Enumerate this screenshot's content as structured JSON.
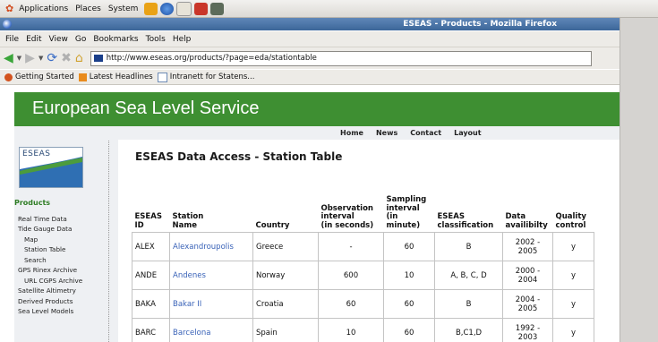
{
  "gnome_panel": {
    "menus": [
      "Applications",
      "Places",
      "System"
    ]
  },
  "window": {
    "title": "ESEAS - Products - Mozilla Firefox"
  },
  "menu_bar": [
    "File",
    "Edit",
    "View",
    "Go",
    "Bookmarks",
    "Tools",
    "Help"
  ],
  "address_bar": {
    "url": "http://www.eseas.org/products/?page=eda/stationtable"
  },
  "bookmarks": [
    "Getting Started",
    "Latest Headlines",
    "Intranett for Statens..."
  ],
  "page": {
    "banner_title": "European Sea Level Service",
    "top_nav": [
      "Home",
      "News",
      "Contact",
      "Layout"
    ],
    "logo_text": "ESEAS",
    "heading": "ESEAS Data Access - Station Table",
    "side_nav": {
      "header": "Products",
      "items": [
        "Real Time Data",
        "Tide Gauge Data",
        "Map",
        "Station Table",
        "Search",
        "GPS Rinex Archive",
        "URL CGPS Archive",
        "Satellite Altimetry",
        "Derived Products",
        "Sea Level Models"
      ]
    },
    "table": {
      "headers": {
        "id": [
          "ESEAS",
          "ID"
        ],
        "name": [
          "Station",
          "Name"
        ],
        "country": [
          "Country"
        ],
        "obs": [
          "Observation",
          "interval",
          "(in seconds)"
        ],
        "samp": [
          "Sampling",
          "interval",
          "(in",
          "minute)"
        ],
        "class": [
          "ESEAS",
          "classification"
        ],
        "avail": [
          "Data",
          "availibilty"
        ],
        "qc": [
          "Quality",
          "control"
        ]
      },
      "rows": [
        {
          "id": "ALEX",
          "name": "Alexandroupolis",
          "country": "Greece",
          "obs": "-",
          "samp": "60",
          "class": "B",
          "avail": [
            "2002 -",
            "2005"
          ],
          "qc": "y"
        },
        {
          "id": "ANDE",
          "name": "Andenes",
          "country": "Norway",
          "obs": "600",
          "samp": "10",
          "class": "A, B, C, D",
          "avail": [
            "2000 -",
            "2004"
          ],
          "qc": "y"
        },
        {
          "id": "BAKA",
          "name": "Bakar II",
          "country": "Croatia",
          "obs": "60",
          "samp": "60",
          "class": "B",
          "avail": [
            "2004 -",
            "2005"
          ],
          "qc": "y"
        },
        {
          "id": "BARC",
          "name": "Barcelona",
          "country": "Spain",
          "obs": "10",
          "samp": "60",
          "class": "B,C1,D",
          "avail": [
            "1992 -",
            "2003"
          ],
          "qc": "y"
        }
      ]
    }
  }
}
